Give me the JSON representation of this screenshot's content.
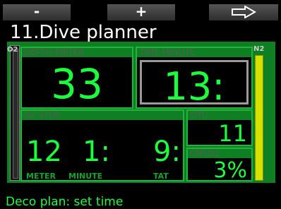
{
  "softkeys": {
    "left": "-",
    "middle": "+",
    "right": "arrow-right-icon"
  },
  "title": "11.Dive planner",
  "side_labels": {
    "left": "O2",
    "right": "N2"
  },
  "depth": {
    "header": "DEPTH   METER",
    "value": "33"
  },
  "time": {
    "header": "TIME   MINUTE",
    "value": "13:"
  },
  "gf_stop": {
    "header": "GF STOP",
    "depth": "12",
    "minute": "1:",
    "tat": "9:",
    "units": {
      "meter": "METER",
      "minute": "MINUTE",
      "tat": "TAT"
    }
  },
  "otu": {
    "header": "OTU",
    "value": "11"
  },
  "cnso2": {
    "header": "CNSO2",
    "value": "3%"
  },
  "status": "Deco plan: set time",
  "colors": {
    "accent": "#19ff3b",
    "panel": "#0e7f22",
    "n2_bar": "#d8e000"
  }
}
